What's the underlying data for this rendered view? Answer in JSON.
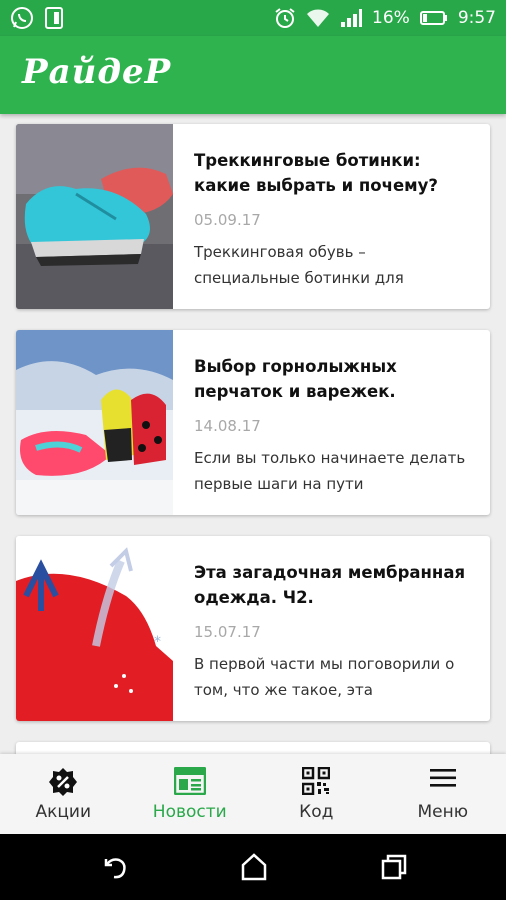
{
  "status_bar": {
    "battery": "16%",
    "time": "9:57"
  },
  "app": {
    "logo": "РайдеР"
  },
  "articles": [
    {
      "title": "Треккинговые ботинки: какие выбрать и почему?",
      "date": "05.09.17",
      "excerpt": "Треккинговая обувь – специальные ботинки для",
      "image": "trekking-boots"
    },
    {
      "title": "Выбор горнолыжных перчаток и варежек.",
      "date": "14.08.17",
      "excerpt": "Если вы только начинаете делать первые шаги на пути",
      "image": "ski-gloves"
    },
    {
      "title": "Эта загадочная мембранная одежда. Ч2.",
      "date": "15.07.17",
      "excerpt": "В первой части мы поговорили о том, что же такое, эта",
      "image": "membrane-fabric"
    }
  ],
  "bottom_nav": {
    "items": [
      {
        "label": "Акции",
        "icon": "discount-badge-icon"
      },
      {
        "label": "Новости",
        "icon": "newspaper-icon",
        "active": true
      },
      {
        "label": "Код",
        "icon": "qr-code-icon"
      },
      {
        "label": "Меню",
        "icon": "hamburger-menu-icon"
      }
    ]
  },
  "colors": {
    "primary": "#2eb34f",
    "status_bar": "#29a84a",
    "active_nav": "#2aa84a"
  }
}
